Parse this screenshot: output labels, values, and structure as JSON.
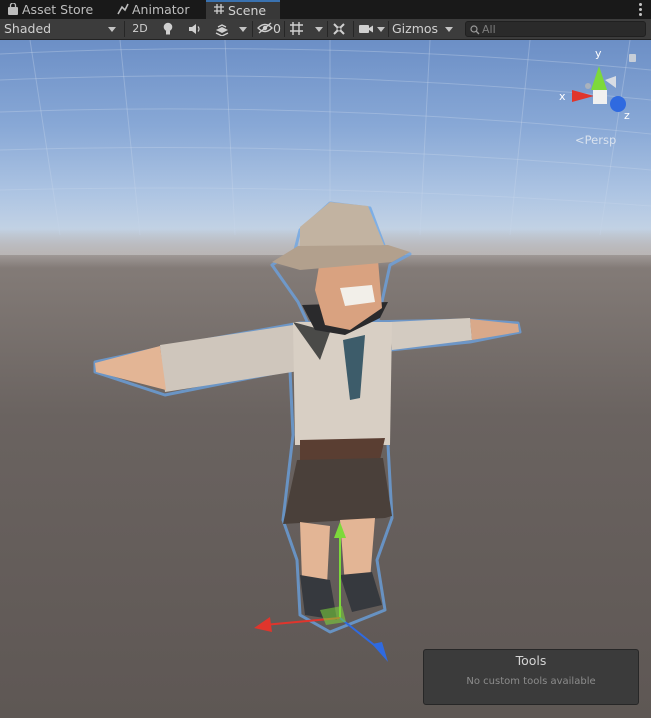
{
  "tabs": [
    {
      "label": "Asset Store",
      "icon": "shopping-bag-icon",
      "active": false
    },
    {
      "label": "Animator",
      "icon": "animator-icon",
      "active": false
    },
    {
      "label": "Scene",
      "icon": "grid-icon",
      "active": true
    }
  ],
  "toolbar": {
    "draw_mode": "Shaded",
    "mode_2d": "2D",
    "hidden_count": "0",
    "gizmos_label": "Gizmos",
    "search_placeholder": "All"
  },
  "viewport": {
    "persp_label": "Persp",
    "axis_labels": {
      "x": "x",
      "y": "y",
      "z": "z"
    }
  },
  "tools_overlay": {
    "title": "Tools",
    "message": "No custom tools available"
  },
  "colors": {
    "accent": "#3a72b0",
    "x_axis": "#e0352c",
    "y_axis": "#7dd93a",
    "z_axis": "#2f6ae0",
    "selection_outline": "#6aa4e6"
  }
}
